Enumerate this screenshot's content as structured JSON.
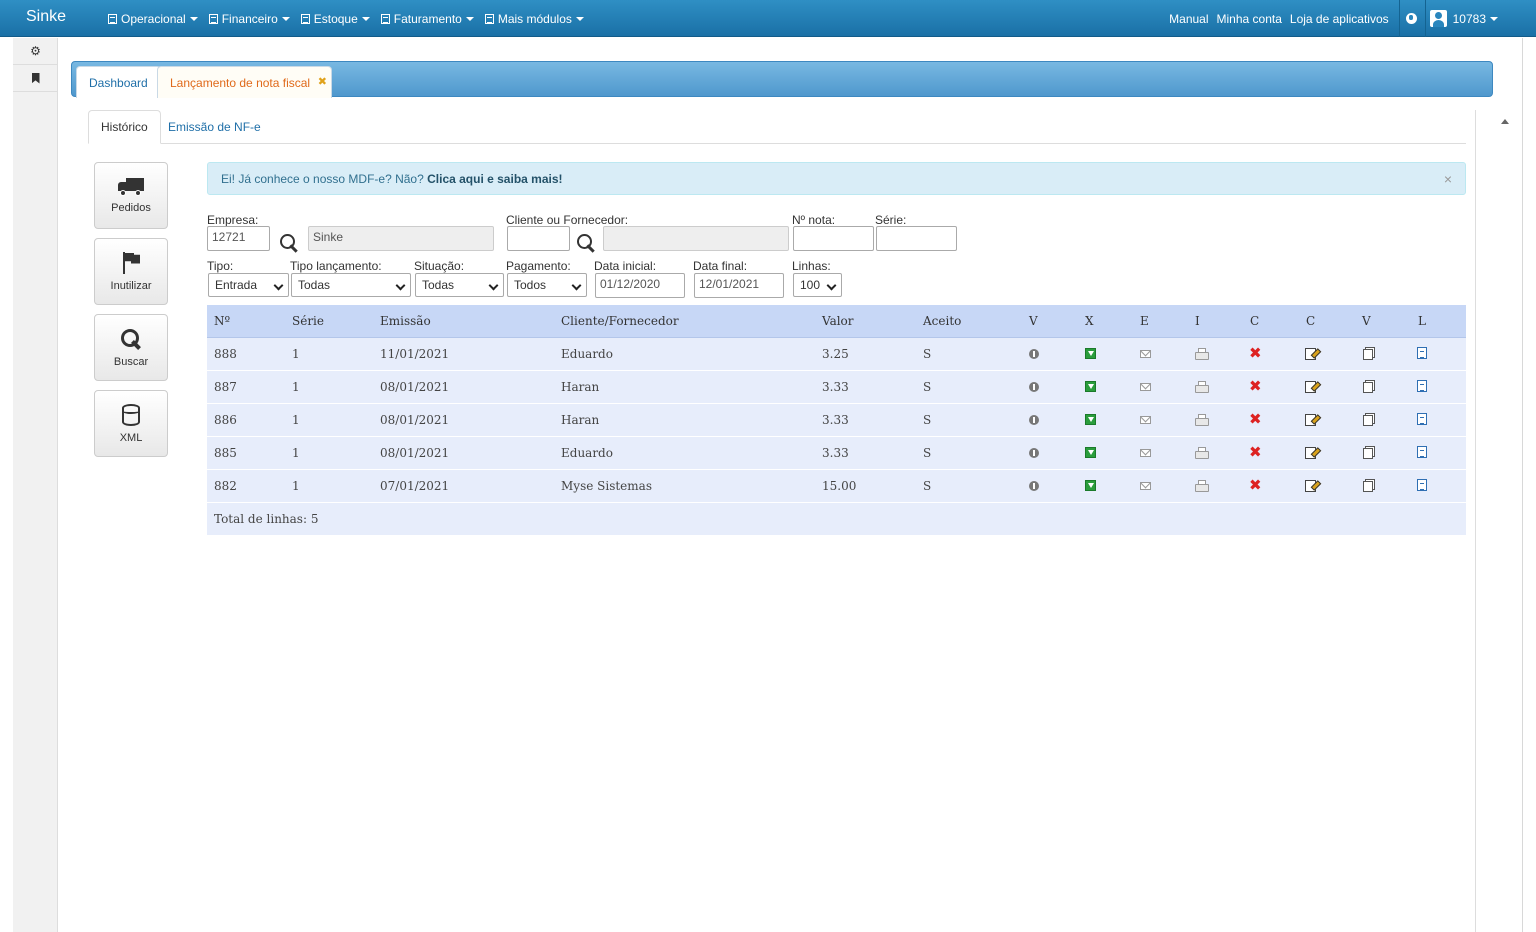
{
  "navbar": {
    "brand": "Sinke",
    "menus": [
      "Operacional",
      "Financeiro",
      "Estoque",
      "Faturamento",
      "Mais módulos"
    ],
    "links": [
      "Manual",
      "Minha conta",
      "Loja de aplicativos"
    ],
    "user_id": "10783"
  },
  "tabs": {
    "dashboard": "Dashboard",
    "nf": "Lançamento de nota fiscal",
    "close_glyph": "✖"
  },
  "subtabs": {
    "historico": "Histórico",
    "emissao": "Emissão de NF-e"
  },
  "actions": [
    "Pedidos",
    "Inutilizar",
    "Buscar",
    "XML"
  ],
  "alert": {
    "text": "Ei! Já conhece o nosso MDF-e? Não? ",
    "link": "Clica aqui e saiba mais!",
    "close": "×"
  },
  "filters": {
    "empresa_label": "Empresa:",
    "empresa_code": "12721",
    "empresa_name": "Sinke",
    "cliente_label": "Cliente ou Fornecedor:",
    "cliente_code": "",
    "cliente_name": "",
    "nota_label": "Nº nota:",
    "nota_value": "",
    "serie_label": "Série:",
    "serie_value": "",
    "tipo_label": "Tipo:",
    "tipo_value": "Entrada",
    "tipo_lanc_label": "Tipo lançamento:",
    "tipo_lanc_value": "Todas",
    "situacao_label": "Situação:",
    "situacao_value": "Todas",
    "pagamento_label": "Pagamento:",
    "pagamento_value": "Todos",
    "data_inicial_label": "Data inicial:",
    "data_inicial_value": "01/12/2020",
    "data_final_label": "Data final:",
    "data_final_value": "12/01/2021",
    "linhas_label": "Linhas:",
    "linhas_value": "100"
  },
  "table": {
    "headers": [
      "Nº",
      "Série",
      "Emissão",
      "Cliente/Fornecedor",
      "Valor",
      "Aceito",
      "V",
      "X",
      "E",
      "I",
      "C",
      "C",
      "V",
      "L"
    ],
    "rows": [
      {
        "numero": "888",
        "serie": "1",
        "emissao": "11/01/2021",
        "cliente": "Eduardo",
        "valor": "3.25",
        "aceito": "S"
      },
      {
        "numero": "887",
        "serie": "1",
        "emissao": "08/01/2021",
        "cliente": "Haran",
        "valor": "3.33",
        "aceito": "S"
      },
      {
        "numero": "886",
        "serie": "1",
        "emissao": "08/01/2021",
        "cliente": "Haran",
        "valor": "3.33",
        "aceito": "S"
      },
      {
        "numero": "885",
        "serie": "1",
        "emissao": "08/01/2021",
        "cliente": "Eduardo",
        "valor": "3.33",
        "aceito": "S"
      },
      {
        "numero": "882",
        "serie": "1",
        "emissao": "07/01/2021",
        "cliente": "Myse Sistemas",
        "valor": "15.00",
        "aceito": "S"
      }
    ],
    "total": "Total de linhas: 5"
  }
}
